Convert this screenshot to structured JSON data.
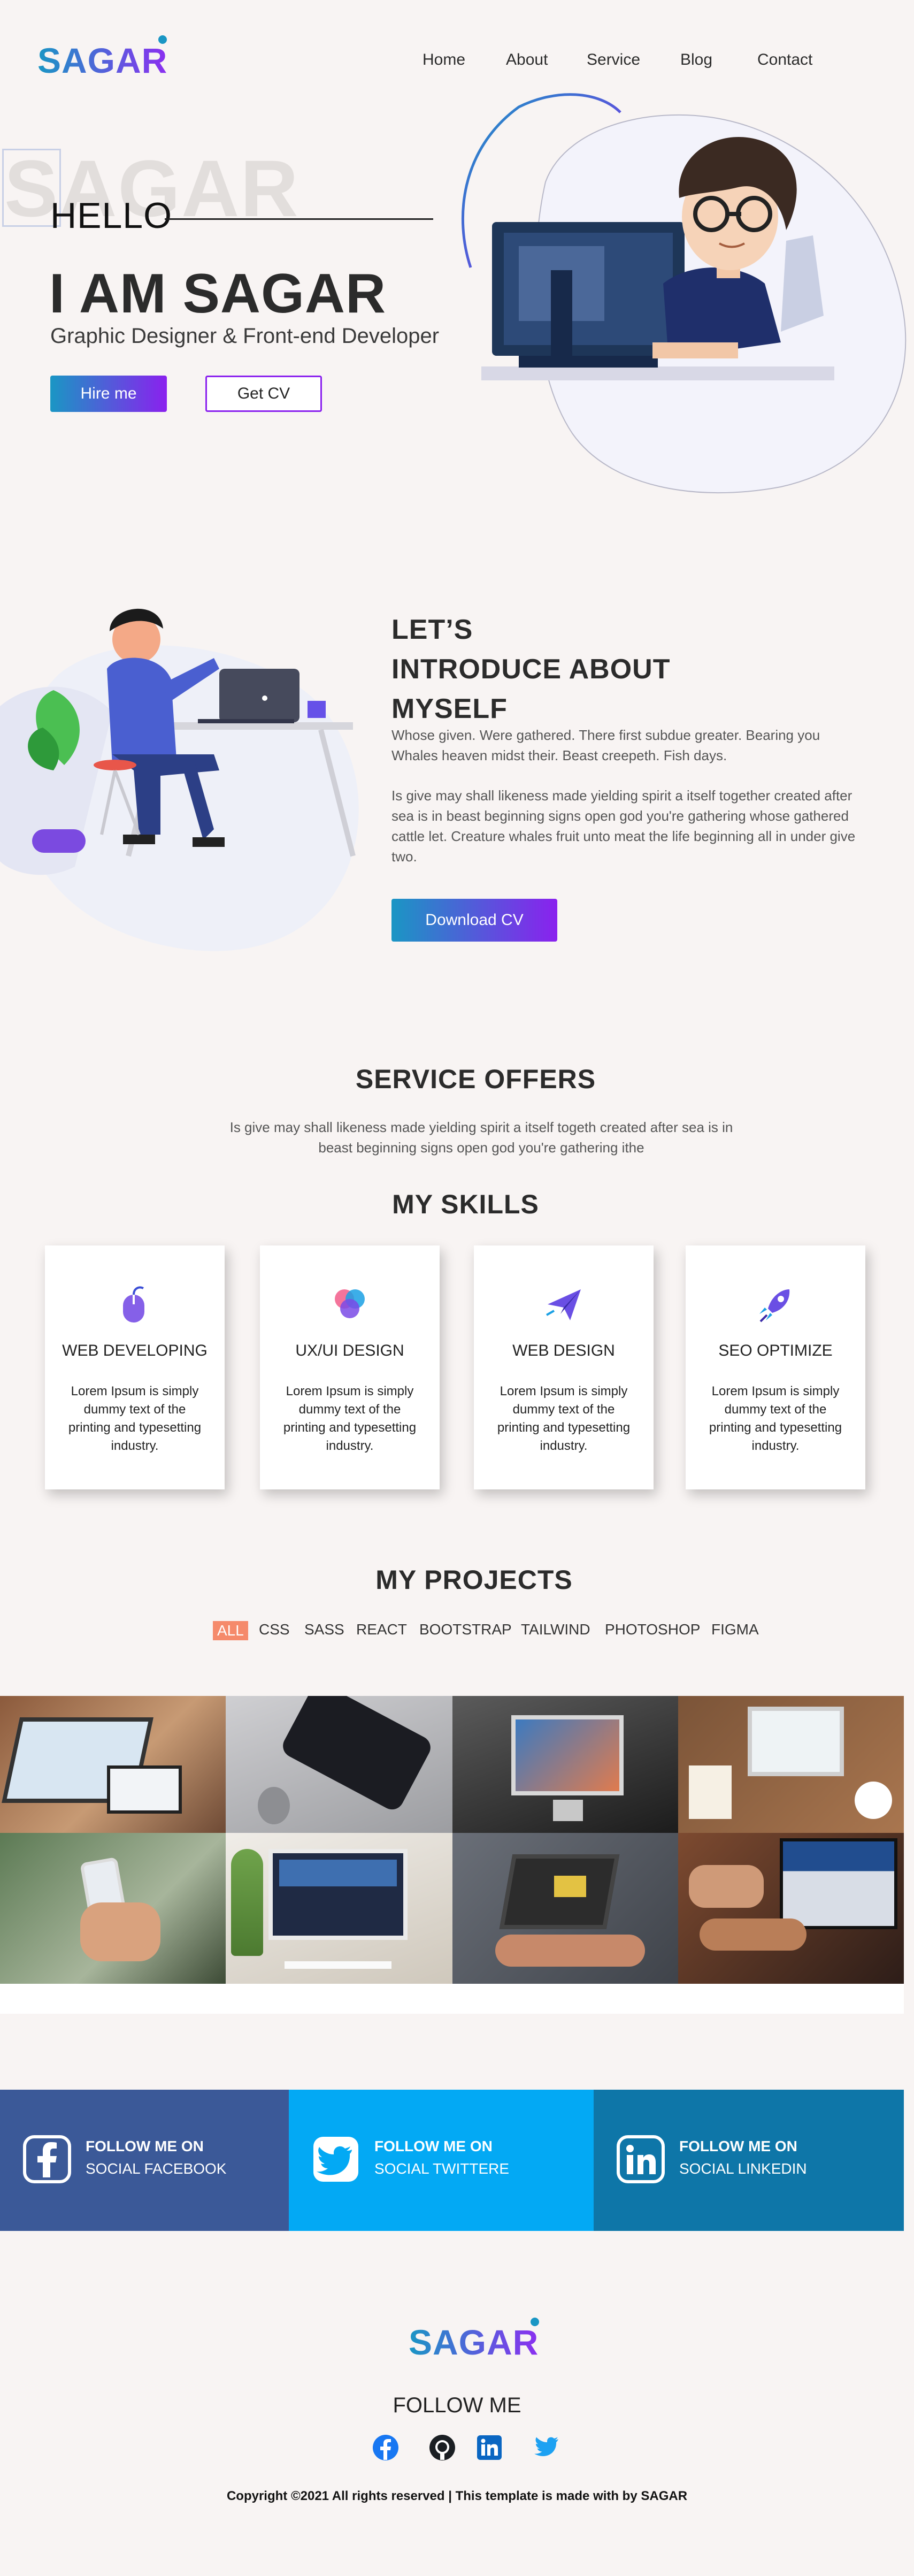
{
  "header": {
    "logo": "SAGAR",
    "nav": [
      "Home",
      "About",
      "Service",
      "Blog",
      "Contact"
    ]
  },
  "hero": {
    "ghost_text": "SAGAR",
    "hello": "HELLO",
    "headline": "I AM SAGAR",
    "subtitle": "Graphic Designer & Front-end Developer",
    "hire_label": "Hire me",
    "cv_label": "Get CV"
  },
  "about": {
    "title_lines": [
      "LET’S",
      "INTRODUCE ABOUT",
      "MYSELF"
    ],
    "para1": "Whose given. Were gathered. There first subdue greater. Bearing you Whales heaven midst their. Beast creepeth. Fish days.",
    "para2": "Is give may shall likeness made yielding spirit a itself together created after sea is in beast beginning signs open god you're gathering whose gathered cattle let. Creature whales fruit unto meat the life beginning all in under give two.",
    "download_label": "Download CV"
  },
  "services": {
    "title": "SERVICE OFFERS",
    "subtitle": "Is give may shall likeness made yielding spirit a itself togeth created after sea is in beast beginning signs open god you're gathering ithe"
  },
  "skills": {
    "title": "MY SKILLS",
    "cards": [
      {
        "title": "WEB DEVELOPING",
        "desc": "Lorem Ipsum is simply dummy text of the printing and typesetting industry.",
        "icon": "mouse-icon"
      },
      {
        "title": "UX/UI DESIGN",
        "desc": "Lorem Ipsum is simply dummy text of the printing and typesetting industry.",
        "icon": "color-circles-icon"
      },
      {
        "title": "WEB DESIGN",
        "desc": "Lorem Ipsum is simply dummy text of the printing and typesetting industry.",
        "icon": "paper-plane-icon"
      },
      {
        "title": "SEO OPTIMIZE",
        "desc": "Lorem Ipsum is simply dummy text of the printing and typesetting industry.",
        "icon": "rocket-icon"
      }
    ]
  },
  "projects": {
    "title": "MY PROJECTS",
    "filters": [
      "ALL",
      "CSS",
      "SASS",
      "REACT",
      "BOOTSTRAP",
      "TAILWIND",
      "PHOTOSHOP",
      "FIGMA"
    ]
  },
  "social": {
    "follow_label": "FOLLOW ME ON",
    "blocks": [
      {
        "label": "SOCIAL FACEBOOK",
        "color": "#3b5998",
        "icon": "facebook-icon"
      },
      {
        "label": "SOCIAL TWITTERE",
        "color": "#03a9f4",
        "icon": "twitter-icon"
      },
      {
        "label": "SOCIAL LINKEDIN",
        "color": "#0e76a8",
        "icon": "linkedin-icon"
      }
    ]
  },
  "footer": {
    "logo": "SAGAR",
    "follow": "FOLLOW ME",
    "icons": [
      "facebook-icon",
      "github-icon",
      "linkedin-icon",
      "twitter-icon"
    ],
    "copyright": "Copyright ©2021 All rights reserved | This template is made with by SAGAR"
  },
  "colors": {
    "brand_start": "#1a96c4",
    "brand_end": "#8a21ee",
    "filter_active": "#f58a6b",
    "background": "#f8f4f3"
  }
}
